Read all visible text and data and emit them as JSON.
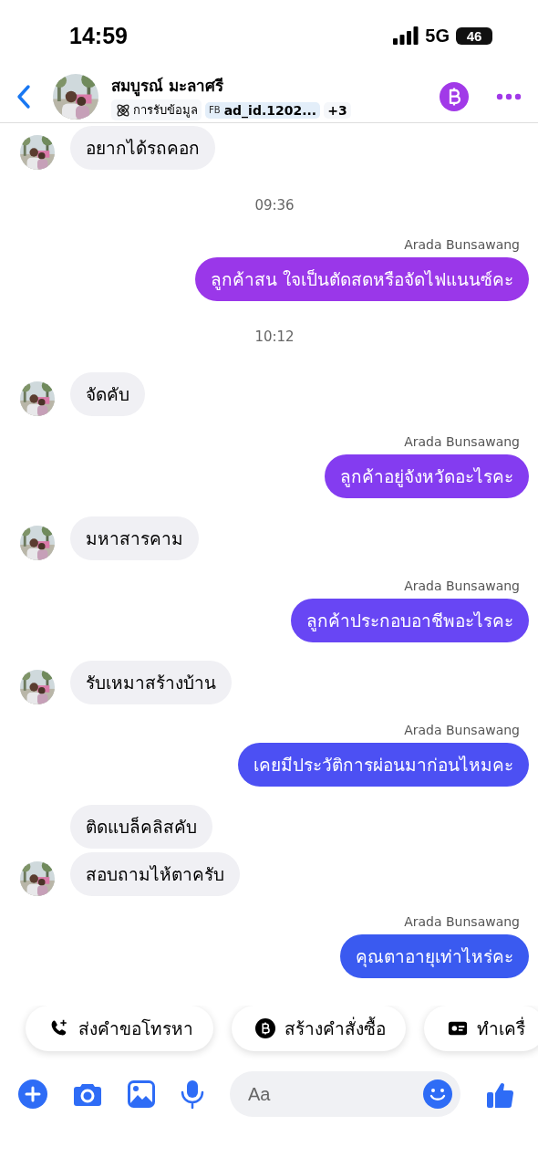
{
  "status_bar": {
    "time": "14:59",
    "network": "5G",
    "battery": "46"
  },
  "header": {
    "contact_name": "สมบูรณ์ มะลาศรี",
    "tags": [
      {
        "kind": "source",
        "label": "การรับข้อมูล"
      },
      {
        "kind": "ad",
        "prefix": "FB",
        "label": "ad_id.1202..."
      },
      {
        "kind": "more",
        "label": "+3"
      }
    ]
  },
  "messages": [
    {
      "kind": "incoming",
      "text": "อยากได้รถคอก",
      "show_avatar": true
    },
    {
      "kind": "timestamp",
      "text": "09:36"
    },
    {
      "kind": "outgoing",
      "sender": "Arada Bunsawang",
      "text": "ลูกค้าสน ใจเป็นตัดสดหรือจัดไฟแนนซ์คะ",
      "color": "#9a37e9"
    },
    {
      "kind": "timestamp",
      "text": "10:12"
    },
    {
      "kind": "incoming",
      "text": "จัดคับ",
      "show_avatar": true
    },
    {
      "kind": "outgoing",
      "sender": "Arada Bunsawang",
      "text": "ลูกค้าอยู่จังหวัดอะไรคะ",
      "color": "#843cf0"
    },
    {
      "kind": "incoming",
      "text": "มหาสารคาม",
      "show_avatar": true
    },
    {
      "kind": "outgoing",
      "sender": "Arada Bunsawang",
      "text": "ลูกค้าประกอบอาชีพอะไรคะ",
      "color": "#6846f4"
    },
    {
      "kind": "incoming",
      "text": "รับเหมาสร้างบ้าน",
      "show_avatar": true
    },
    {
      "kind": "outgoing",
      "sender": "Arada Bunsawang",
      "text": "เคยมีประวัติการผ่อนมาก่อนไหมคะ",
      "color": "#4c50f3"
    },
    {
      "kind": "incoming",
      "text": "ติดแบล็คลิสคับ",
      "show_avatar": false
    },
    {
      "kind": "incoming",
      "text": "สอบถามไห้ตาครับ",
      "show_avatar": true
    },
    {
      "kind": "outgoing",
      "sender": "Arada Bunsawang",
      "text": "คุณตาอายุเท่าไหร่คะ",
      "color": "#3a5af0"
    }
  ],
  "quick_actions": [
    {
      "kind": "call",
      "label": "ส่งคำขอโทรหา"
    },
    {
      "kind": "order",
      "label": "สร้างคำสั่งซื้อ"
    },
    {
      "kind": "card",
      "label": "ทำเครื่"
    }
  ],
  "composer": {
    "placeholder": "Aa"
  }
}
